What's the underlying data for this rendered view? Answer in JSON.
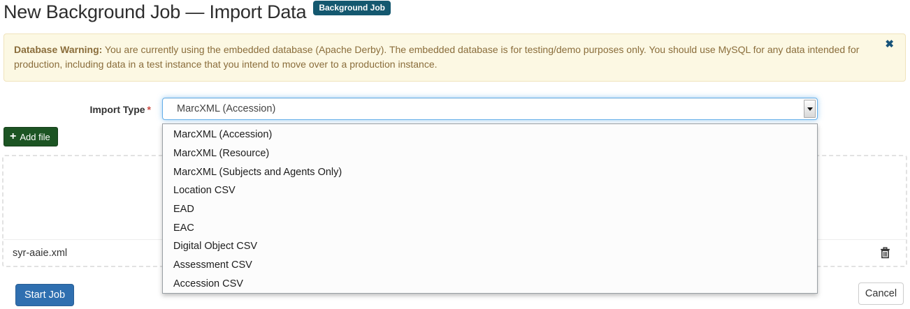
{
  "page": {
    "title": "New Background Job — Import Data",
    "badge": "Background Job"
  },
  "warning": {
    "label": "Database Warning:",
    "text": " You are currently using the embedded database (Apache Derby). The embedded database is for testing/demo purposes only. You should use MySQL for any data intended for production, including data in a test instance that you intend to move over to a production instance.",
    "close_icon": "✖"
  },
  "form": {
    "import_type_label": "Import Type",
    "required_marker": "*",
    "selected_value": "MarcXML (Accession)",
    "options": [
      "MarcXML (Accession)",
      "MarcXML (Resource)",
      "MarcXML (Subjects and Agents Only)",
      "Location CSV",
      "EAD",
      "EAC",
      "Digital Object CSV",
      "Assessment CSV",
      "Accession CSV"
    ],
    "add_file": {
      "plus_icon": "+",
      "label": "Add file"
    }
  },
  "files": [
    {
      "name": "syr-aaie.xml",
      "delete_icon": "trash"
    }
  ],
  "actions": {
    "start_label": "Start Job",
    "cancel_label": "Cancel"
  },
  "colors": {
    "badge_bg": "#14586f",
    "warning_bg": "#fcf8e3",
    "warning_text": "#8a6d3b",
    "add_file_bg": "#1c5423",
    "start_bg": "#2f6fb0",
    "focus_glow": "#66afe9",
    "required_red": "#cb4a42"
  }
}
